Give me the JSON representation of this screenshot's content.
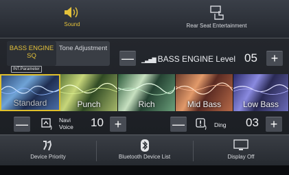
{
  "top_tabs": {
    "sound": {
      "label": "Sound",
      "icon": "speaker-icon"
    },
    "rear_seat": {
      "label": "Rear Seat Entertainment",
      "icon": "rear-seat-icon"
    }
  },
  "mode_tabs": {
    "bass_engine_sq": "BASS ENGINE SQ",
    "tone_adjustment": "Tone Adjustment"
  },
  "param_tag": "INT.Parameter",
  "bass_level": {
    "label": "BASS ENGINE Level",
    "value": "05",
    "minus": "—",
    "plus": "+"
  },
  "presets": [
    {
      "label": "Standard",
      "selected": true
    },
    {
      "label": "Punch",
      "selected": false
    },
    {
      "label": "Rich",
      "selected": false
    },
    {
      "label": "Mid Bass",
      "selected": false
    },
    {
      "label": "Low Bass",
      "selected": false
    }
  ],
  "navi_voice": {
    "label_line1": "Navi",
    "label_line2": "Voice",
    "value": "10",
    "minus": "—",
    "plus": "+"
  },
  "ding": {
    "label": "Ding",
    "value": "03",
    "minus": "—",
    "plus": "+"
  },
  "footer": {
    "device_priority": "Device Priority",
    "bluetooth_device_list": "Bluetooth Device List",
    "display_off": "Display Off"
  },
  "colors": {
    "accent": "#e3c13a",
    "selected_border": "#e0c02c"
  }
}
